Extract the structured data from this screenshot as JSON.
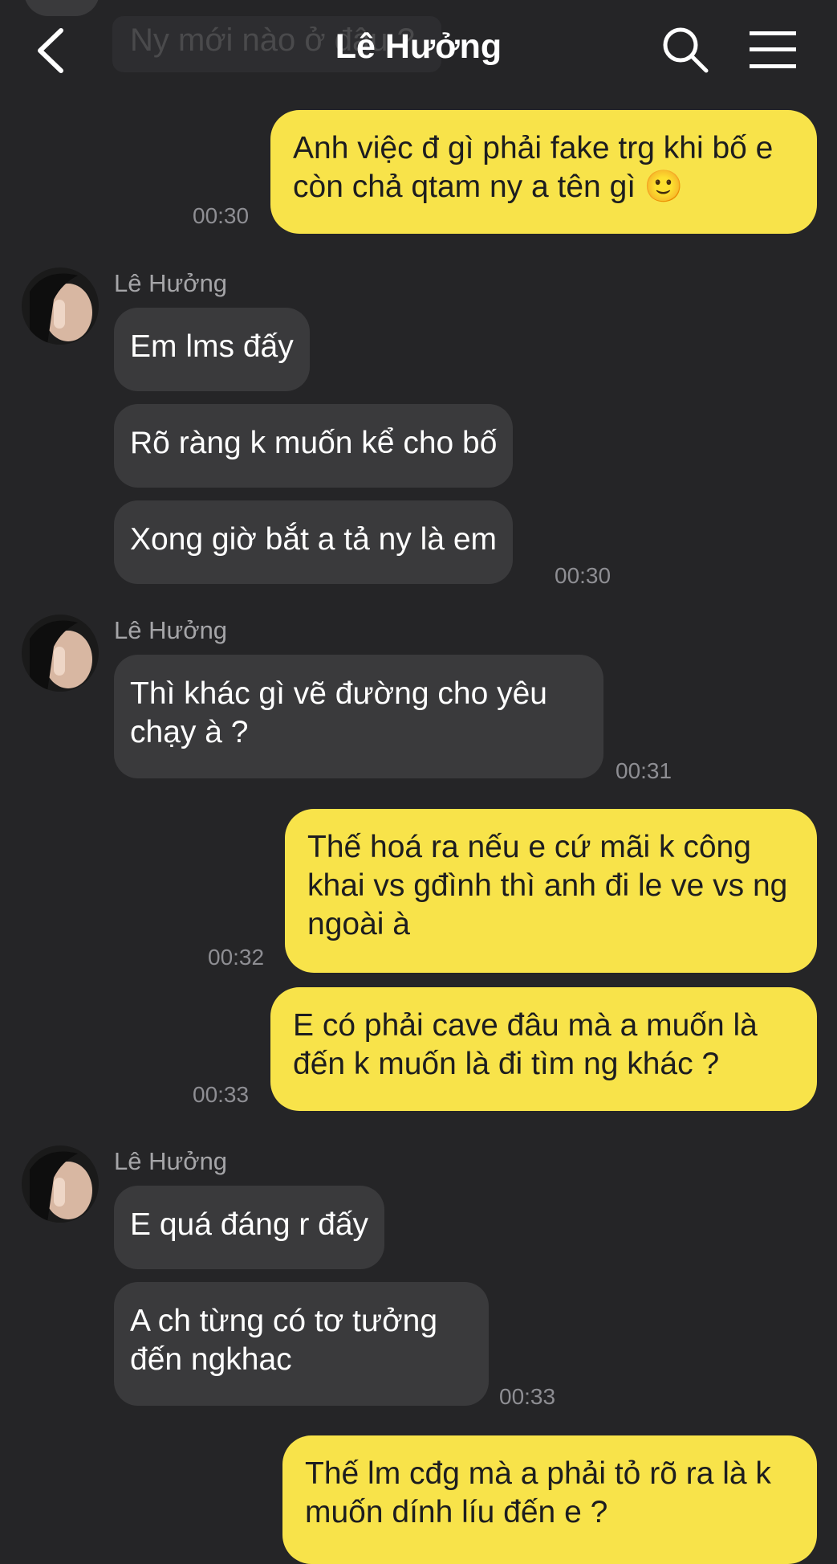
{
  "header": {
    "title": "Lê Hưởng",
    "prev_message_partial": "Ny mới nào ở đâu ?"
  },
  "contact_name": "Lê Hưởng",
  "messages": [
    {
      "dir": "out",
      "text": "Anh việc đ gì phải fake trg khi bố e còn chả qtam ny a tên gì 🙂",
      "time": "00:30"
    },
    {
      "dir": "in",
      "sender": "Lê Hưởng",
      "text": "Em lms đấy"
    },
    {
      "dir": "in",
      "text": "Rõ ràng k muốn kể cho bố"
    },
    {
      "dir": "in",
      "text": "Xong giờ bắt a tả ny là em",
      "time": "00:30"
    },
    {
      "dir": "in",
      "sender": "Lê Hưởng",
      "text": "Thì khác gì vẽ đường cho yêu chạy à ?",
      "time": "00:31"
    },
    {
      "dir": "out",
      "text": "Thế hoá ra nếu e cứ mãi k công khai vs gđình thì anh đi le ve vs ng ngoài à",
      "time": "00:32"
    },
    {
      "dir": "out",
      "text": "E có phải cave đâu mà a muốn là đến k muốn là đi tìm ng khác ?",
      "time": "00:33"
    },
    {
      "dir": "in",
      "sender": "Lê Hưởng",
      "text": "E quá đáng r đấy"
    },
    {
      "dir": "in",
      "text": "A ch từng có tơ tưởng đến ngkhac",
      "time": "00:33"
    },
    {
      "dir": "out",
      "text": "Thế lm cđg mà a phải tỏ rõ ra là k muốn dính líu đến e ?"
    }
  ],
  "icons": [
    "back-icon",
    "search-icon",
    "menu-icon"
  ],
  "colors": {
    "background": "#252527",
    "outgoing_bubble": "#f8e34a",
    "incoming_bubble": "#3a3a3c",
    "timestamp": "#8e8e93"
  }
}
